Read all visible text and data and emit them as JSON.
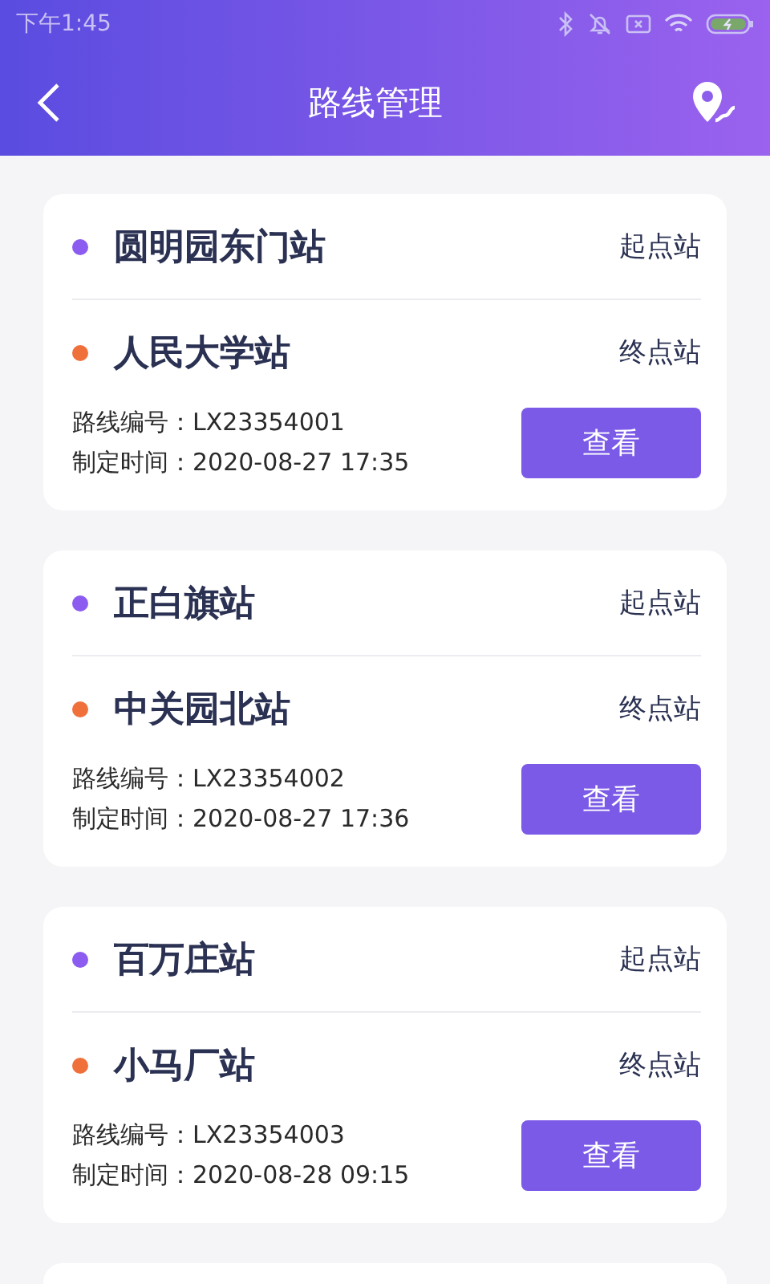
{
  "status_bar": {
    "time": "下午1:45"
  },
  "header": {
    "title": "路线管理"
  },
  "routes": [
    {
      "stations": [
        {
          "name": "圆明园东门站",
          "role": "起点站",
          "color": "#8c5cf0"
        },
        {
          "name": "人民大学站",
          "role": "终点站",
          "color": "#f0703c"
        }
      ],
      "number_label": "路线编号：",
      "number": "LX23354001",
      "time_label": "制定时间：",
      "time": "2020-08-27 17:35",
      "button": "查看"
    },
    {
      "stations": [
        {
          "name": "正白旗站",
          "role": "起点站",
          "color": "#8c5cf0"
        },
        {
          "name": "中关园北站",
          "role": "终点站",
          "color": "#f0703c"
        }
      ],
      "number_label": "路线编号：",
      "number": "LX23354002",
      "time_label": "制定时间：",
      "time": "2020-08-27 17:36",
      "button": "查看"
    },
    {
      "stations": [
        {
          "name": "百万庄站",
          "role": "起点站",
          "color": "#8c5cf0"
        },
        {
          "name": "小马厂站",
          "role": "终点站",
          "color": "#f0703c"
        }
      ],
      "number_label": "路线编号：",
      "number": "LX23354003",
      "time_label": "制定时间：",
      "time": "2020-08-28 09:15",
      "button": "查看"
    }
  ]
}
